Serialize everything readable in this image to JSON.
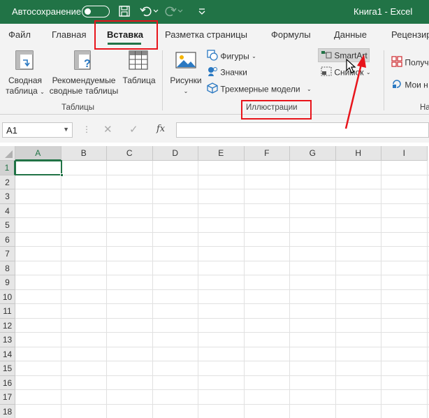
{
  "titlebar": {
    "autosave_label": "Автосохранение",
    "doc_title": "Книга1  -  Excel",
    "bg_color": "#217346"
  },
  "tabs": [
    {
      "label": "Файл"
    },
    {
      "label": "Главная"
    },
    {
      "label": "Вставка",
      "active": true
    },
    {
      "label": "Разметка страницы"
    },
    {
      "label": "Формулы"
    },
    {
      "label": "Данные"
    },
    {
      "label": "Рецензир"
    }
  ],
  "ribbon": {
    "tables": {
      "pivot_line1": "Сводная",
      "pivot_line2": "таблица",
      "recommended_line1": "Рекомендуемые",
      "recommended_line2": "сводные таблицы",
      "table": "Таблица",
      "group_label": "Таблицы"
    },
    "illustrations": {
      "pictures": "Рисунки",
      "shapes": "Фигуры",
      "icons": "Значки",
      "models_3d": "Трехмерные модели",
      "smartart": "SmartArt",
      "screenshot": "Снимок",
      "group_label": "Иллюстрации"
    },
    "addins": {
      "get": "Получ",
      "my": "Мои н",
      "group_label_partial": "На"
    }
  },
  "formula_bar": {
    "name_box": "A1",
    "fx": "fx",
    "value": ""
  },
  "sheet": {
    "columns": [
      "A",
      "B",
      "C",
      "D",
      "E",
      "F",
      "G",
      "H",
      "I"
    ],
    "rows": [
      "1",
      "2",
      "3",
      "4",
      "5",
      "6",
      "7",
      "8",
      "9",
      "10",
      "11",
      "12",
      "13",
      "14",
      "15",
      "16",
      "17",
      "18"
    ],
    "selected_cell": "A1"
  },
  "annotations": {
    "highlight_color": "#e8141b"
  }
}
